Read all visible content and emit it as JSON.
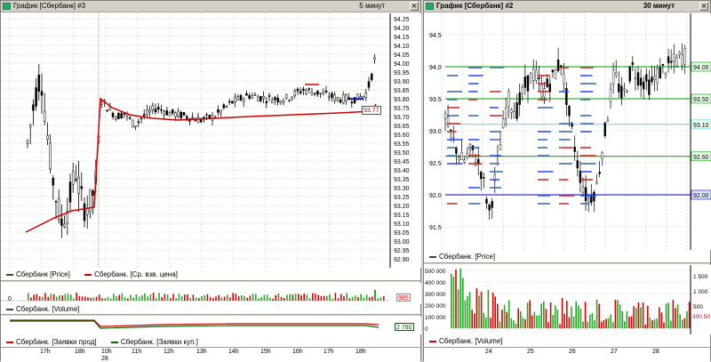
{
  "left": {
    "title": "График [Сбербанк] #3",
    "timeframe": "5 минут",
    "price_axis": [
      "94.25",
      "94.20",
      "94.15",
      "94.10",
      "94.05",
      "94.00",
      "93.95",
      "93.90",
      "93.85",
      "93.80",
      "93.75",
      "93.70",
      "93.65",
      "93.60",
      "93.55",
      "93.50",
      "93.45",
      "93.40",
      "93.35",
      "93.30",
      "93.25",
      "93.20",
      "93.15",
      "93.10",
      "93.05",
      "93.00",
      "92.95",
      "92.90"
    ],
    "vwap_marker": "93.77",
    "legend_price": "Сбербанк [Price]",
    "legend_vwap": "Сбербанк. [Ср. взв. цена]",
    "volume_zero": "0",
    "volume_value": "985",
    "legend_volume": "Сбербанк. [Volume]",
    "orders_value": "2 780",
    "legend_orders_sell": "Сбербанк. [Заявки прод]",
    "legend_orders_buy": "Сбербанк. [Заявки куп.]",
    "time_labels": [
      "17h",
      "18h",
      "10h",
      "11h",
      "12h",
      "13h",
      "14h",
      "15h",
      "16h",
      "17h",
      "18h"
    ],
    "date_label": "28"
  },
  "right": {
    "title": "График [Сбербанк] #2",
    "timeframe": "30 минут",
    "price_axis": [
      "94.5",
      "94.0",
      "93.5",
      "93.0",
      "92.5",
      "92.0",
      "91.5"
    ],
    "level_labels": [
      "94.00",
      "93.50",
      "93.10",
      "92.60",
      "92.00"
    ],
    "legend_price": "Сбербанк. [Price]",
    "volume_axis_left": [
      "500 000",
      "400 000",
      "300 000",
      "200 000",
      "100 000",
      "0"
    ],
    "volume_axis_right": [
      "1 500",
      "1 000",
      "500"
    ],
    "volume_value": "300 50",
    "legend_volume": "Сбербанк. [Volume]",
    "time_labels": [
      "24",
      "25",
      "26",
      "27",
      "28"
    ]
  },
  "colors": {
    "up_candle": "#000000",
    "vwap": "#cc0000",
    "volume_up": "#22aa22",
    "volume_down": "#dd0000",
    "level_green": "#009900",
    "level_blue": "#0000cc",
    "grid": "#c8c8a8"
  },
  "icons": {
    "window_icon": "chart-window-icon",
    "close": "close-icon"
  }
}
